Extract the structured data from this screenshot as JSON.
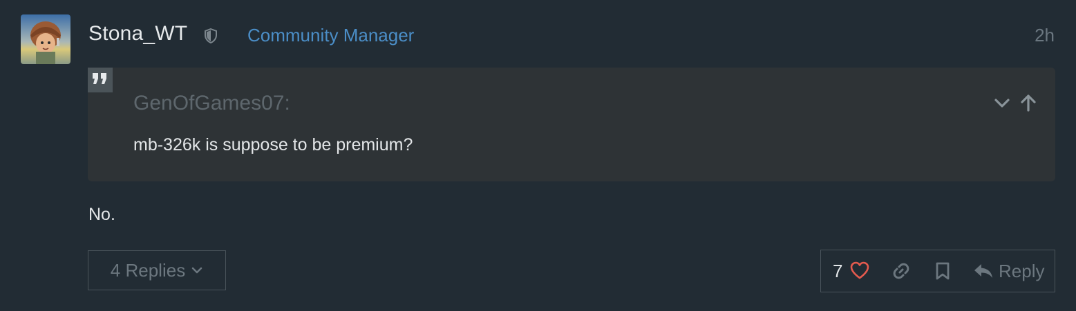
{
  "post": {
    "username": "Stona_WT",
    "user_title": "Community Manager",
    "date": "2h",
    "body": "No."
  },
  "quote": {
    "author": "GenOfGames07:",
    "text": "mb-326k is suppose to be premium?"
  },
  "replies": {
    "label": "4 Replies"
  },
  "actions": {
    "like_count": "7",
    "reply_label": "Reply"
  },
  "colors": {
    "background": "#222c34",
    "quote_background": "#2e3336",
    "accent": "#4b8ec7",
    "like": "#e45a4e",
    "muted": "#6c777f"
  },
  "icons": [
    "shield-icon",
    "quote-icon",
    "chevron-down-icon",
    "arrow-up-icon",
    "heart-icon",
    "link-icon",
    "bookmark-icon",
    "reply-icon"
  ]
}
